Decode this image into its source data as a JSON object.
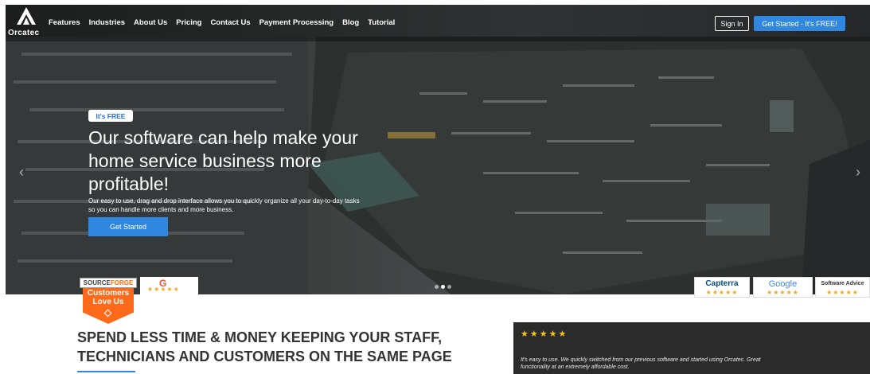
{
  "header": {
    "logo_text": "Orcatec",
    "nav_items": [
      "Features",
      "Industries",
      "About Us",
      "Pricing",
      "Contact Us",
      "Payment Processing",
      "Blog",
      "Tutorial"
    ],
    "sign_in_label": "Sign In",
    "get_started_label": "Get Started - It's FREE!"
  },
  "hero": {
    "badge": "It's FREE",
    "headline_line1": "Our software can help make your",
    "headline_line2": "home service business more",
    "headline_line3": "profitable!",
    "subtext_line1": "Our easy to use, drag and drop interface allows you to quickly organize all your day-to-day tasks",
    "subtext_line2": "so you can handle more clients and more business.",
    "cta_label": "Get Started",
    "prev_arrow": "‹",
    "next_arrow": "›",
    "slide_count": 3,
    "active_slide": 2
  },
  "badges": {
    "sourceforge_top_a": "SOURCE",
    "sourceforge_top_b": "FORGE",
    "sourceforge_line1": "Customers",
    "sourceforge_line2": "Love Us",
    "g2_logo": "G",
    "g2_stars": "★★★★★",
    "capterra_name": "Capterra",
    "capterra_stars": "★★★★★",
    "google_name": "Google",
    "google_stars": "★★★★★",
    "advice_name": "Software Advice",
    "advice_stars": "★★★★★"
  },
  "main": {
    "title_line1": "SPEND LESS TIME & MONEY KEEPING YOUR STAFF,",
    "title_line2": "TECHNICIANS AND CUSTOMERS ON THE SAME PAGE"
  },
  "testimonial": {
    "stars": "★★★★★",
    "text_line1": "It's easy to use. We quickly switched from our previous software and started using Orcatec. Great",
    "text_line2": "functionality at an extremely affordable cost."
  },
  "colors": {
    "accent": "#2f87e0",
    "sourceforge_orange": "#ff6a1a",
    "star_gold": "#f5a623",
    "testimonial_bg": "#2b2b2b"
  }
}
